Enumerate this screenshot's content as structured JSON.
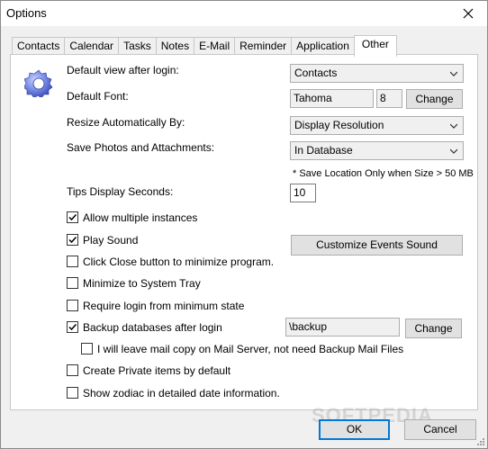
{
  "window": {
    "title": "Options"
  },
  "tabs": [
    {
      "label": "Contacts"
    },
    {
      "label": "Calendar"
    },
    {
      "label": "Tasks"
    },
    {
      "label": "Notes"
    },
    {
      "label": "E-Mail"
    },
    {
      "label": "Reminder"
    },
    {
      "label": "Application"
    },
    {
      "label": "Other",
      "active": true
    }
  ],
  "settings": {
    "default_view": {
      "label": "Default view after login:",
      "value": "Contacts"
    },
    "default_font": {
      "label": "Default Font:",
      "font": "Tahoma",
      "size": "8",
      "change_label": "Change"
    },
    "resize": {
      "label": "Resize Automatically By:",
      "value": "Display Resolution"
    },
    "save_photos": {
      "label": "Save Photos and Attachments:",
      "value": "In Database",
      "note": "* Save Location Only when Size > 50 MB"
    },
    "tips": {
      "label": "Tips Display Seconds:",
      "value": "10"
    },
    "customize_sound_label": "Customize Events Sound",
    "backup": {
      "path": "\\backup",
      "change_label": "Change"
    }
  },
  "checkboxes": [
    {
      "label": "Allow multiple instances",
      "checked": true
    },
    {
      "label": "Play Sound",
      "checked": true
    },
    {
      "label": "Click Close button to minimize program.",
      "checked": false
    },
    {
      "label": "Minimize to System Tray",
      "checked": false
    },
    {
      "label": "Require login from minimum state",
      "checked": false
    },
    {
      "label": "Backup databases after login",
      "checked": true
    },
    {
      "label": "I will leave mail copy on Mail Server, not need Backup Mail Files",
      "checked": false
    },
    {
      "label": "Create Private items by default",
      "checked": false
    },
    {
      "label": "Show zodiac in detailed date information.",
      "checked": false
    }
  ],
  "footer": {
    "ok_label": "OK",
    "cancel_label": "Cancel",
    "watermark": "SOFTPEDIA"
  },
  "colors": {
    "accent": "#0078d7",
    "panel": "#ffffff",
    "chrome": "#f0f0f0"
  }
}
